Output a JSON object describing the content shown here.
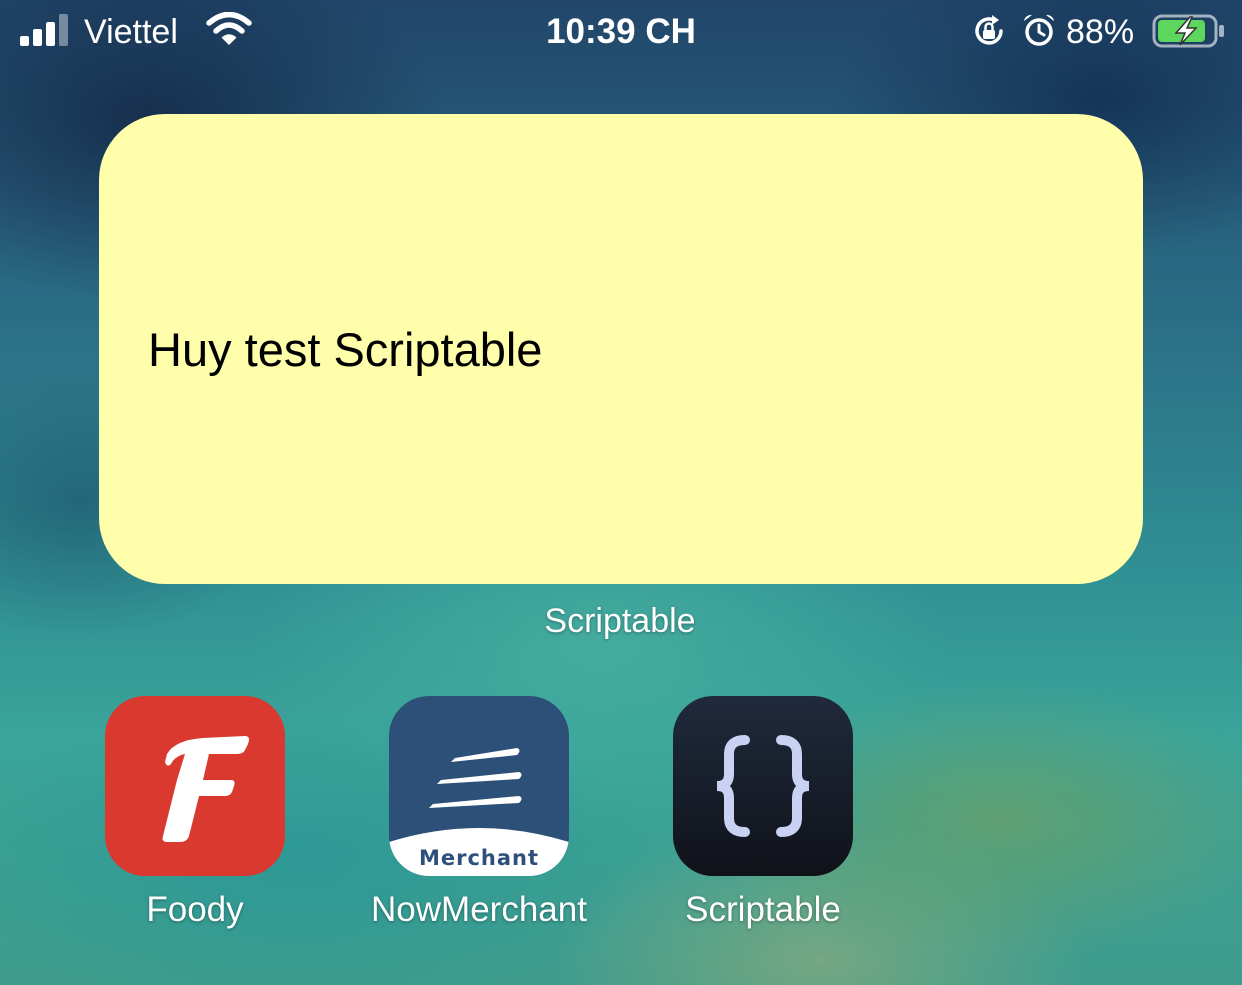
{
  "status_bar": {
    "carrier": "Viettel",
    "time": "10:39 CH",
    "battery_percent": "88%",
    "icons": [
      "signal-icon",
      "wifi-icon",
      "rotation-lock-icon",
      "alarm-icon",
      "battery-charging-icon"
    ]
  },
  "widget": {
    "text": "Huy test Scriptable",
    "label": "Scriptable",
    "background_color": "#fffeaa"
  },
  "apps": [
    {
      "name": "Foody",
      "icon": "foody-icon",
      "color": "#d9392f"
    },
    {
      "name": "NowMerchant",
      "icon": "nowmerchant-icon",
      "color": "#2c5078",
      "icon_text": "Merchant"
    },
    {
      "name": "Scriptable",
      "icon": "scriptable-icon",
      "color": "#161a24"
    }
  ]
}
